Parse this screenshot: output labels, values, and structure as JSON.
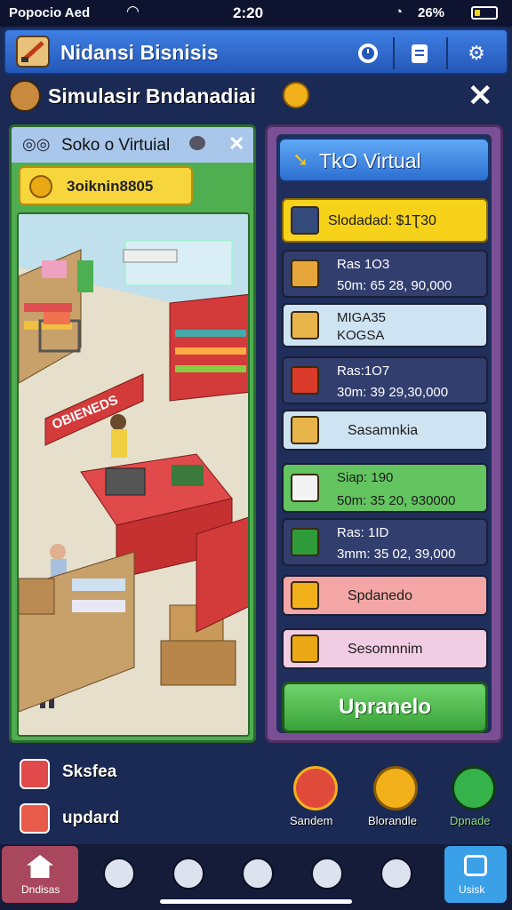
{
  "status_bar": {
    "carrier": "Popocio Aed",
    "time": "2:20",
    "battery": "26%",
    "battery_level": 0.26
  },
  "header": {
    "title": "Nidansi Bisnisis",
    "icons": [
      "clock-icon",
      "clipboard-icon",
      "gear-icon"
    ]
  },
  "subheader": {
    "title": "Simulasir Bndanadiai"
  },
  "left_panel": {
    "title": "Soko o Virtuial",
    "coins": "3oiknin8805",
    "scene_sign": "OBIENEDS"
  },
  "right_panel": {
    "title": "TkO Virtual",
    "balance": "Slodadad: $1Ʈ30",
    "items": [
      {
        "line1": "Ras 1O3",
        "line2": "50m: 65 28, 90,000",
        "color": "#323e6e",
        "icon_color": "#e7a63a",
        "text_color": "#ffffff"
      },
      {
        "line1": "MIGA35",
        "line2": "KOGSA",
        "color": "#cfe4f3",
        "icon_color": "#e9b54a",
        "text_color": "#1b1b1b"
      },
      {
        "line1": "Ras:1O7",
        "line2": "30m: 39 29,30,000",
        "color": "#323e6e",
        "icon_color": "#d93a2a",
        "text_color": "#ffffff"
      },
      {
        "line1": "Sasamnkia",
        "line2": "",
        "color": "#cfe4f3",
        "icon_color": "#e9b54a",
        "text_color": "#1b1b1b"
      },
      {
        "line1": "Siap: 190",
        "line2": "50m: 35 20, 930000",
        "color": "#63c460",
        "icon_color": "#f3f3f3",
        "text_color": "#1b1b1b"
      },
      {
        "line1": "Ras: 1ID",
        "line2": "3mm: 35 02, 39,000",
        "color": "#323e6e",
        "icon_color": "#2f9a3a",
        "text_color": "#ffffff"
      },
      {
        "line1": "Spdanedo",
        "line2": "",
        "color": "#f4a6a6",
        "icon_color": "#f2b11b",
        "text_color": "#1b1b1b"
      },
      {
        "line1": "Sesomnnim",
        "line2": "",
        "color": "#f1cde4",
        "icon_color": "#eaa815",
        "text_color": "#1b1b1b"
      }
    ],
    "upgrade_label": "Upranelo"
  },
  "actions": {
    "left": [
      {
        "label": "Sksfea",
        "icon": "ticket-icon"
      },
      {
        "label": "updard",
        "icon": "list-icon"
      }
    ],
    "round": [
      {
        "label": "Sandem",
        "icon": "shopper-icon",
        "color": "#e04a3a"
      },
      {
        "label": "Blorandle",
        "icon": "badge-icon",
        "color": "#f2b11b"
      },
      {
        "label": "Dpnade",
        "icon": "upgrade-icon",
        "color": "#36b24a"
      }
    ]
  },
  "nav": {
    "home_label": "Dndisas",
    "last_label": "Usisk",
    "middle_icons": [
      "search-icon",
      "bell-icon",
      "compass-icon",
      "profile-icon",
      "target-icon"
    ]
  }
}
